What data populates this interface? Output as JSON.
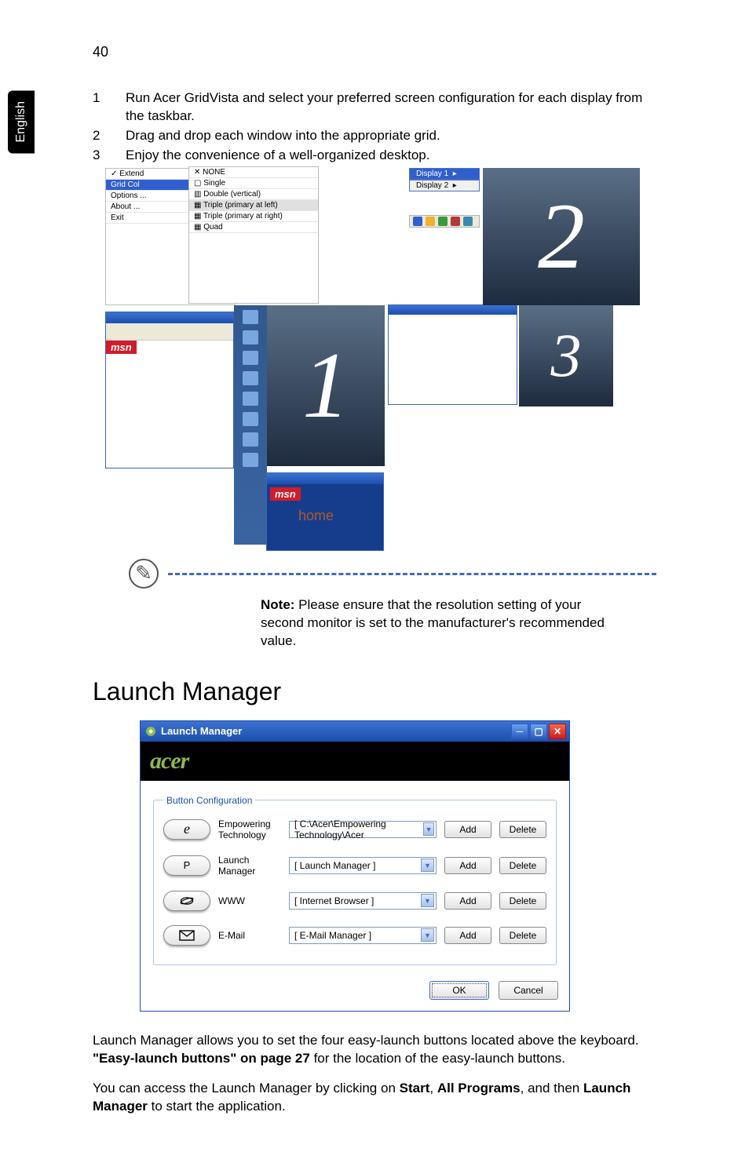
{
  "page": {
    "number": "40",
    "language_tab": "English"
  },
  "steps": [
    {
      "num": "1",
      "text": "Run Acer GridVista and select your preferred screen configuration for each display from the taskbar."
    },
    {
      "num": "2",
      "text": "Drag and drop each window into the appropriate grid."
    },
    {
      "num": "3",
      "text": "Enjoy the convenience of a well-organized desktop."
    }
  ],
  "gridvista_menu": {
    "extend": "Extend",
    "gridcolor": "Grid Col",
    "options": "Options ...",
    "about": "About ...",
    "exit": "Exit",
    "items": [
      "NONE",
      "Single",
      "Double (vertical)",
      "Triple (primary at left)",
      "Triple (primary at right)",
      "Quad"
    ]
  },
  "display_labels": {
    "d1": "Display 1",
    "d2": "Display 2"
  },
  "panel_numbers": {
    "one": "1",
    "two": "2",
    "three": "3"
  },
  "brand": "msn",
  "home_label": "home",
  "note": {
    "label": "Note:",
    "text": " Please ensure that the resolution setting of your second monitor is set to the manufacturer's recommended value."
  },
  "launch_manager": {
    "heading": "Launch Manager",
    "window_title": "Launch Manager",
    "acer_logo": "acer",
    "legend": "Button Configuration",
    "rows": [
      {
        "key": "e",
        "label_a": "Empowering",
        "label_b": "Technology",
        "value": "[  C:\\Acer\\Empowering Technology\\Acer",
        "dd": true
      },
      {
        "key": "P",
        "label": "Launch Manager",
        "value": "[  Launch Manager  ]",
        "dd": true
      },
      {
        "key": "www",
        "label": "WWW",
        "value": "[  Internet Browser  ]",
        "dd": true
      },
      {
        "key": "mail",
        "label": "E-Mail",
        "value": "[  E-Mail Manager  ]",
        "dd": true
      }
    ],
    "add": "Add",
    "delete": "Delete",
    "ok": "OK",
    "cancel": "Cancel"
  },
  "paragraphs": {
    "p1a": "Launch Manager allows you to set the four easy-launch buttons located above the keyboard. ",
    "p1b": "\"Easy-launch buttons\" on page 27",
    "p1c": " for the location of the easy-launch buttons.",
    "p2a": "You can access the Launch Manager by clicking on ",
    "p2b": "Start",
    "p2c": ", ",
    "p2d": "All Programs",
    "p2e": ", and then ",
    "p2f": "Launch Manager",
    "p2g": " to start the application."
  }
}
